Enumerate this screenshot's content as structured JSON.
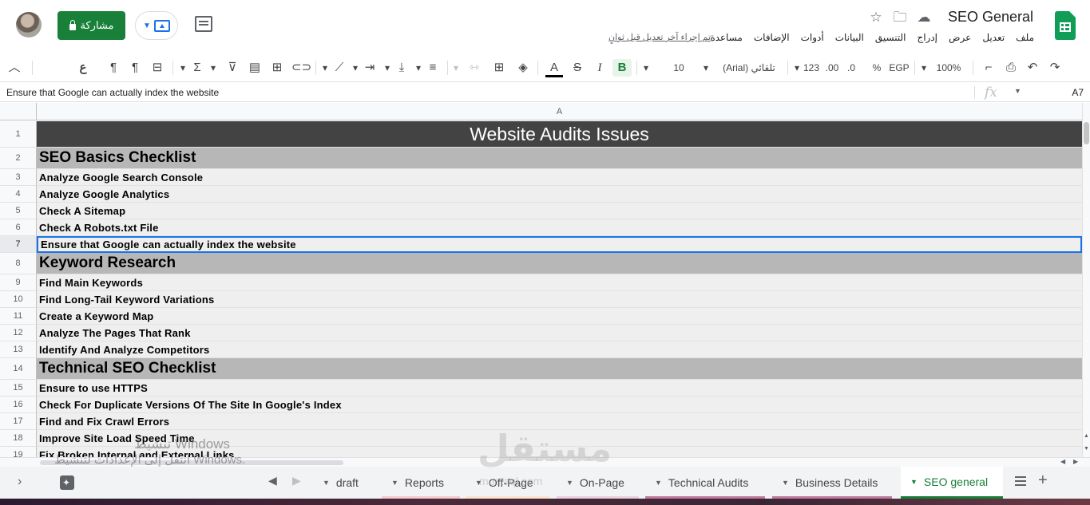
{
  "header": {
    "doc_title": "SEO General",
    "menu": [
      "ملف",
      "تعديل",
      "عرض",
      "إدراج",
      "التنسيق",
      "البيانات",
      "أدوات",
      "الإضافات",
      "مساعدة"
    ],
    "last_edit": "تم إجراء آخر تعديل قبل ثوانٍ",
    "share_label": "مشاركة",
    "icons": [
      "cloud-icon",
      "folder-move-icon",
      "star-icon"
    ]
  },
  "toolbar": {
    "zoom": "100%",
    "currency": "EGP",
    "percent": "%",
    "dec_decrease": ".0",
    "dec_increase": ".00",
    "number_format": "123",
    "font": "(Arial) تلقائي",
    "font_size": "10",
    "bold": "B",
    "italic": "I",
    "strikethrough": "S",
    "text_color": "A",
    "sum": "Σ",
    "special_char": "ع"
  },
  "formula_bar": {
    "cell_ref": "A7",
    "content": "Ensure that Google can actually index the website",
    "fx_label": "fx"
  },
  "grid": {
    "column_header": "A",
    "rows": [
      {
        "num": "1",
        "text": "Website Audits Issues",
        "kind": "title"
      },
      {
        "num": "2",
        "text": "SEO Basics Checklist",
        "kind": "section"
      },
      {
        "num": "3",
        "text": "Analyze Google Search Console",
        "kind": "item"
      },
      {
        "num": "4",
        "text": "Analyze Google Analytics",
        "kind": "item"
      },
      {
        "num": "5",
        "text": "Check A Sitemap",
        "kind": "item"
      },
      {
        "num": "6",
        "text": "Check A Robots.txt File",
        "kind": "item"
      },
      {
        "num": "7",
        "text": "Ensure that Google can actually index the website",
        "kind": "item",
        "selected": true
      },
      {
        "num": "8",
        "text": "Keyword Research",
        "kind": "section"
      },
      {
        "num": "9",
        "text": "Find Main Keywords",
        "kind": "item"
      },
      {
        "num": "10",
        "text": "Find Long-Tail Keyword Variations",
        "kind": "item"
      },
      {
        "num": "11",
        "text": "Create a Keyword Map",
        "kind": "item"
      },
      {
        "num": "12",
        "text": "Analyze The Pages That Rank",
        "kind": "item"
      },
      {
        "num": "13",
        "text": "Identify And Analyze Competitors",
        "kind": "item"
      },
      {
        "num": "14",
        "text": "Technical SEO Checklist",
        "kind": "section"
      },
      {
        "num": "15",
        "text": "Ensure to use HTTPS",
        "kind": "item"
      },
      {
        "num": "16",
        "text": "Check For Duplicate Versions Of The Site In Google's Index",
        "kind": "item"
      },
      {
        "num": "17",
        "text": "Find and Fix Crawl Errors",
        "kind": "item"
      },
      {
        "num": "18",
        "text": "Improve Site Load Speed Time",
        "kind": "item"
      },
      {
        "num": "19",
        "text": "Fix Broken Internal and External Links",
        "kind": "item"
      }
    ]
  },
  "sheets": {
    "tabs": [
      {
        "label": "draft",
        "color": ""
      },
      {
        "label": "Reports",
        "color": "#f4cccc"
      },
      {
        "label": "Off-Page",
        "color": "#fce5cd"
      },
      {
        "label": "On-Page",
        "color": "#ead1dc"
      },
      {
        "label": "Technical Audits",
        "color": "#c27ba0"
      },
      {
        "label": "Business Details",
        "color": "#c27ba0"
      },
      {
        "label": "SEO general",
        "color": "#188038",
        "active": true
      }
    ]
  },
  "watermarks": {
    "windows_line1": "تنشيط Windows",
    "windows_line2": "انتقل إلى الإعدادات لتنشيط Windows.",
    "site": "مستقل",
    "site_sub": "mostaql.com"
  },
  "colors": {
    "title_bg": "#434343",
    "section_bg": "#b7b7b7",
    "item_bg": "#efefef",
    "accent": "#188038",
    "selection": "#1a73e8"
  }
}
